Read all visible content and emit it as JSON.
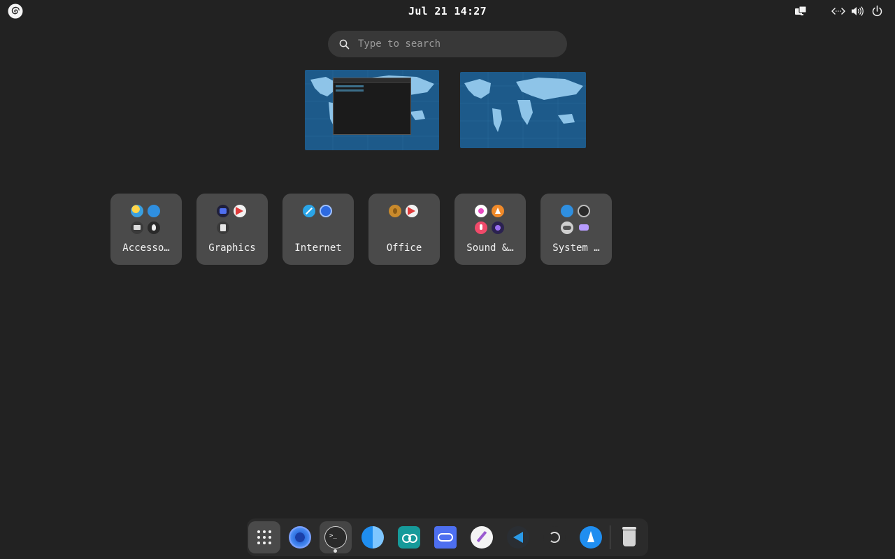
{
  "topbar": {
    "clock": "Jul 21  14:27",
    "icons": [
      "debian-logo-icon",
      "screen-share-icon",
      "network-wired-icon",
      "volume-icon",
      "power-icon"
    ]
  },
  "search": {
    "placeholder": "Type to search"
  },
  "workspaces": [
    {
      "name": "workspace-1",
      "has_window": true
    },
    {
      "name": "workspace-2",
      "has_window": false
    }
  ],
  "folders": [
    {
      "label": "Accesso…",
      "icons": [
        "weather-icon",
        "globe-icon",
        "printer-icon",
        "ink-icon"
      ]
    },
    {
      "label": "Graphics",
      "icons": [
        "scanner-icon",
        "vector-icon",
        "document-viewer-icon"
      ]
    },
    {
      "label": "Internet",
      "icons": [
        "safari-compass-icon",
        "wireguard-icon"
      ]
    },
    {
      "label": "Office",
      "icons": [
        "money-icon",
        "vector-icon"
      ]
    },
    {
      "label": "Sound &…",
      "icons": [
        "music-icon",
        "vlc-icon",
        "microphone-icon",
        "nebula-icon"
      ]
    },
    {
      "label": "System …",
      "icons": [
        "globe-icon",
        "settings-icon",
        "toggle-icon",
        "chat-icon"
      ]
    }
  ],
  "dock": {
    "items": [
      "app-grid-icon",
      "browser-icon",
      "terminal-icon",
      "finder-icon",
      "arduino-icon",
      "cloud-sync-icon",
      "text-editor-icon",
      "vscode-icon",
      "obs-icon",
      "app-store-icon",
      "trash-icon"
    ],
    "active": "terminal-icon"
  },
  "colors": {
    "background": "#222222",
    "folder": "#4a4a4a",
    "search": "#383838",
    "dock": "#2b2b2b",
    "map_ocean": "#1d5a8a",
    "map_land": "#8ec4e8"
  }
}
